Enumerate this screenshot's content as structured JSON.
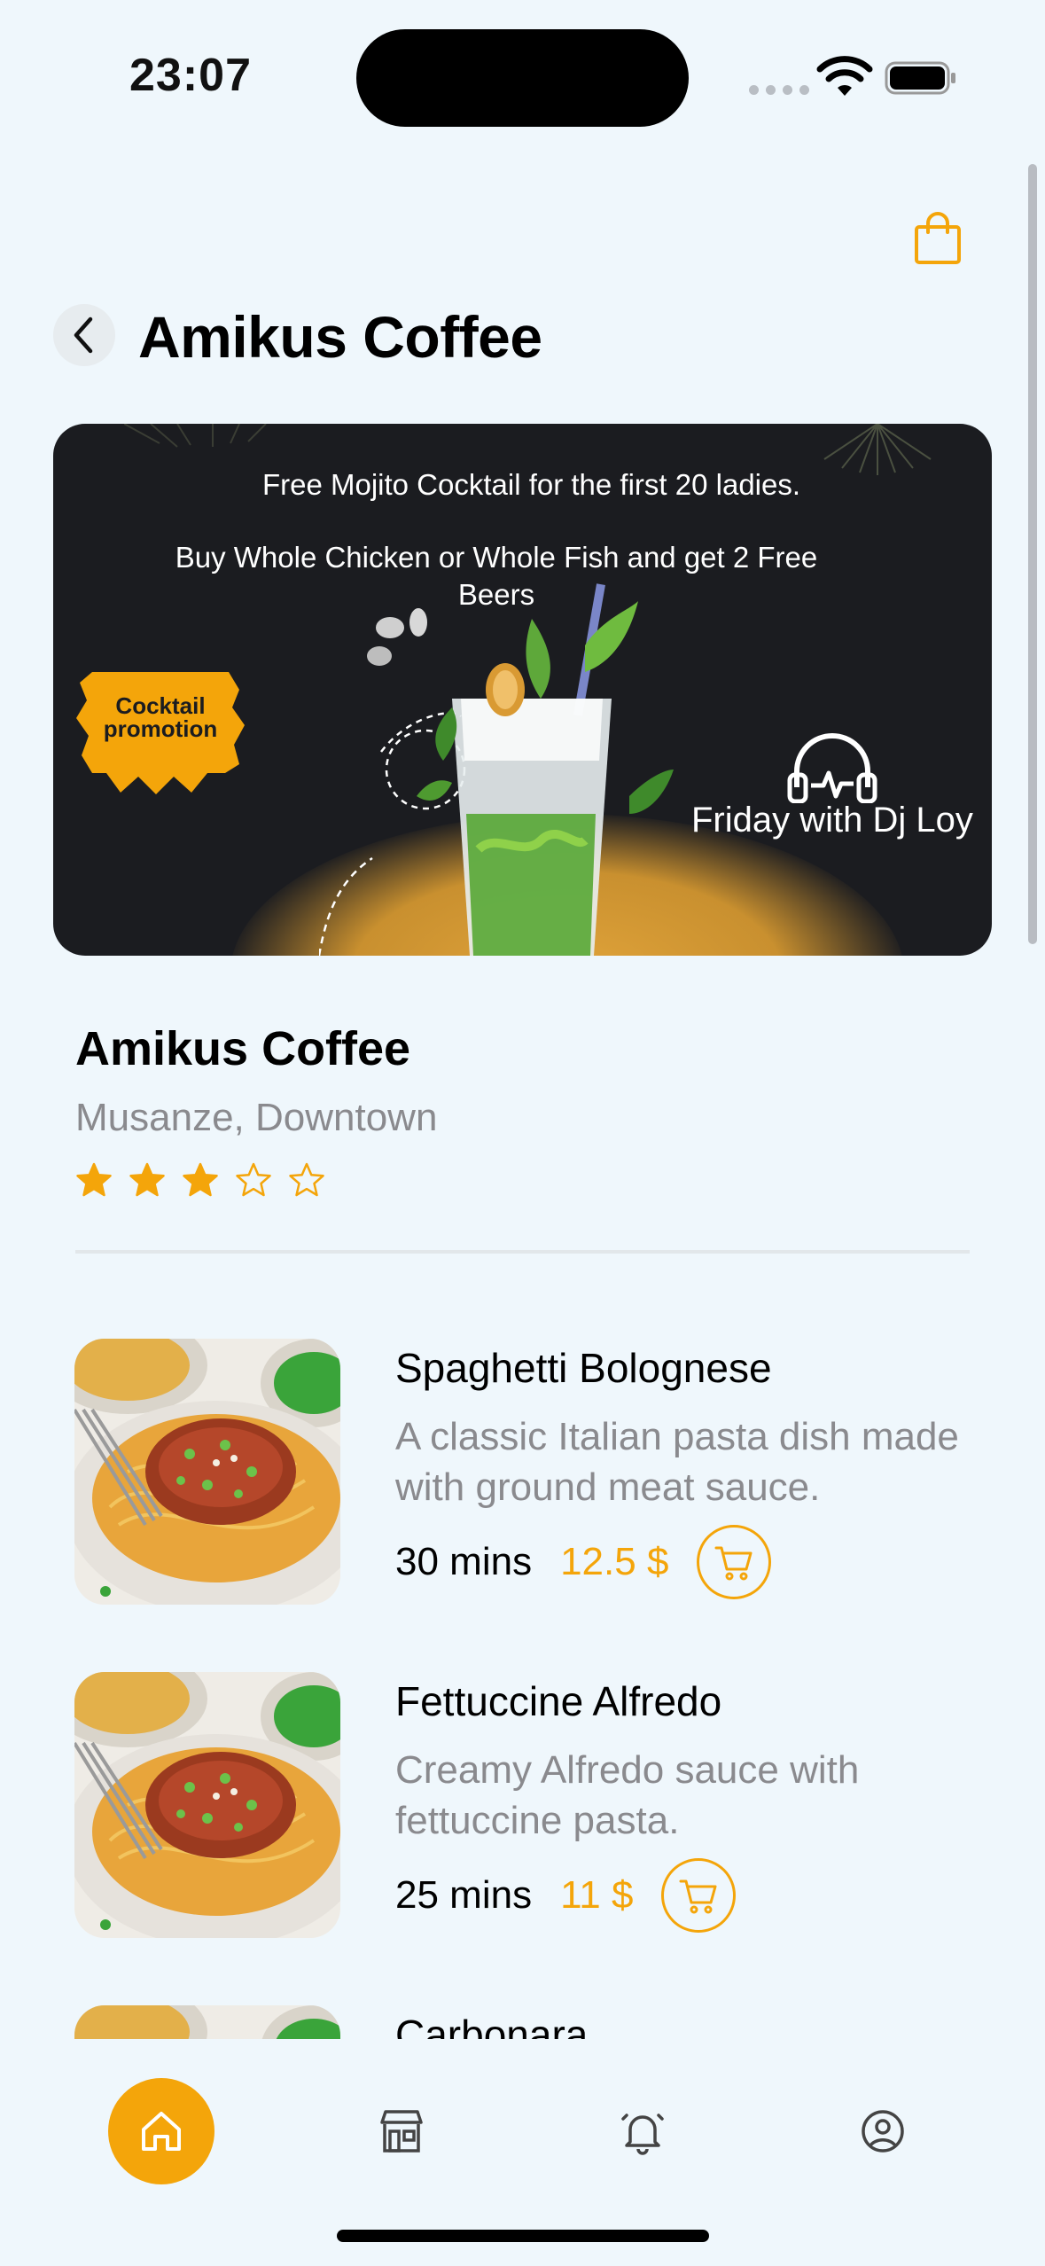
{
  "status_bar": {
    "time": "23:07"
  },
  "header": {
    "title": "Amikus Coffee",
    "back_icon": "chevron-left-icon",
    "bag_icon": "shopping-bag-icon"
  },
  "banner": {
    "line1": "Free Mojito Cocktail for the first 20 ladies.",
    "line2": "Buy Whole Chicken or Whole Fish and get 2 Free Beers",
    "badge_line1": "Cocktail",
    "badge_line2": "promotion",
    "dj": "Friday with Dj Loy"
  },
  "restaurant": {
    "name": "Amikus Coffee",
    "location": "Musanze, Downtown",
    "rating": 3,
    "rating_max": 5
  },
  "menu": [
    {
      "title": "Spaghetti Bolognese",
      "description": "A classic Italian pasta dish made with ground meat sauce.",
      "time": "30 mins",
      "price": "12.5 $"
    },
    {
      "title": "Fettuccine Alfredo",
      "description": "Creamy Alfredo sauce with fettuccine pasta.",
      "time": "25 mins",
      "price": "11 $"
    },
    {
      "title": "Carbonara",
      "description": "",
      "time": "",
      "price": ""
    }
  ],
  "tabs": [
    {
      "name": "tab-home",
      "icon": "home-icon",
      "active": true
    },
    {
      "name": "tab-store",
      "icon": "store-icon",
      "active": false
    },
    {
      "name": "tab-notifications",
      "icon": "bell-icon",
      "active": false
    },
    {
      "name": "tab-profile",
      "icon": "user-circle-icon",
      "active": false
    }
  ],
  "colors": {
    "accent": "#f4a50a",
    "background": "#eff7fc",
    "banner": "#1b1c20",
    "muted_text": "#8a8a8e"
  }
}
